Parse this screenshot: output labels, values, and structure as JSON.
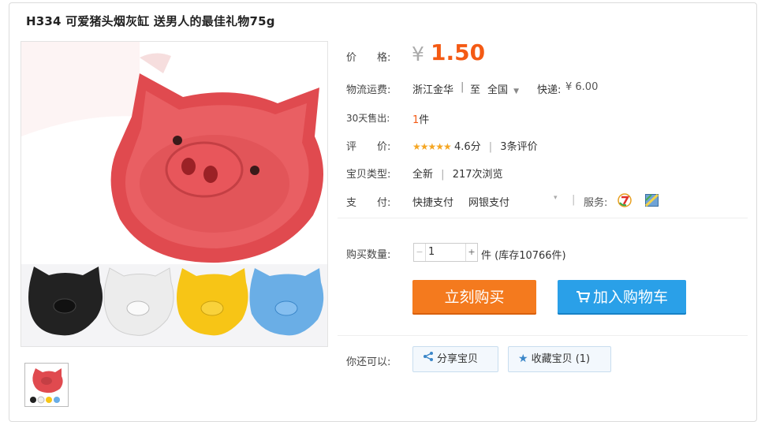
{
  "product": {
    "title": "H334 可爱猪头烟灰缸 送男人的最佳礼物75g"
  },
  "price": {
    "label": "价　　格:",
    "currency": "¥",
    "value": "1.50",
    "color": "#f45a14"
  },
  "shipping": {
    "label": "物流运费:",
    "from": "浙江金华",
    "sep1": "|",
    "to_prefix": "至",
    "to": "全国",
    "express_label": "快递:",
    "express_price": "¥ 6.00"
  },
  "sales": {
    "label": "30天售出:",
    "count": "1",
    "unit": "件"
  },
  "rating": {
    "label": "评　　价:",
    "score": "4.6分",
    "reviews": "3条评价",
    "stars_fraction": 0.92
  },
  "type": {
    "label": "宝贝类型:",
    "condition": "全新",
    "views": "217次浏览"
  },
  "payment": {
    "label": "支　　付:",
    "methods": [
      "快捷支付",
      "网银支付"
    ],
    "service_label": "服务:"
  },
  "quantity": {
    "label": "购买数量:",
    "value": "1",
    "unit_stock": "件 (库存10766件)"
  },
  "actions": {
    "buy": "立刻购买",
    "cart": "加入购物车"
  },
  "extra": {
    "label": "你还可以:",
    "share": "分享宝贝",
    "favorite": "收藏宝贝 (1)"
  }
}
